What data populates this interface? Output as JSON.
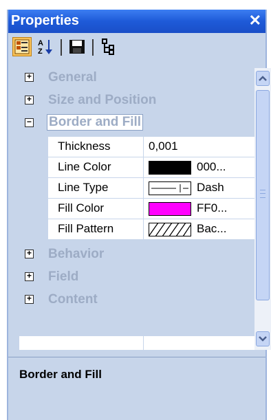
{
  "window": {
    "title": "Properties",
    "close_glyph": "✕"
  },
  "toolbar": {
    "buttons": [
      {
        "name": "categorized-icon",
        "active": true
      },
      {
        "name": "sort-alpha-icon",
        "label": "A Z"
      },
      {
        "name": "save-icon"
      },
      {
        "name": "tree-icon"
      }
    ]
  },
  "categories": [
    {
      "label": "General",
      "expander": "+"
    },
    {
      "label": "Size and Position",
      "expander": "+"
    },
    {
      "label": "Border and Fill",
      "expander": "−"
    },
    {
      "label": "Behavior",
      "expander": "+"
    },
    {
      "label": "Field",
      "expander": "+"
    },
    {
      "label": "Content",
      "expander": "+"
    }
  ],
  "properties": [
    {
      "name": "Thickness",
      "value": "0,001"
    },
    {
      "name": "Line Color",
      "value": "000...",
      "swatch": "#000000"
    },
    {
      "name": "Line Type",
      "value": "Dash",
      "swatch_icon": "dash-line-icon"
    },
    {
      "name": "Fill Color",
      "value": "FF0...",
      "swatch": "#ff00ff"
    },
    {
      "name": "Fill Pattern",
      "value": "Bac...",
      "swatch_icon": "hatch-pattern-icon"
    }
  ],
  "description": {
    "title": "Border and Fill",
    "text": ""
  },
  "colors": {
    "titlebar": "#1e5ad8",
    "panel": "#c7d5ea",
    "category_text": "#9dacc5",
    "active_button": "#f8c25a"
  }
}
